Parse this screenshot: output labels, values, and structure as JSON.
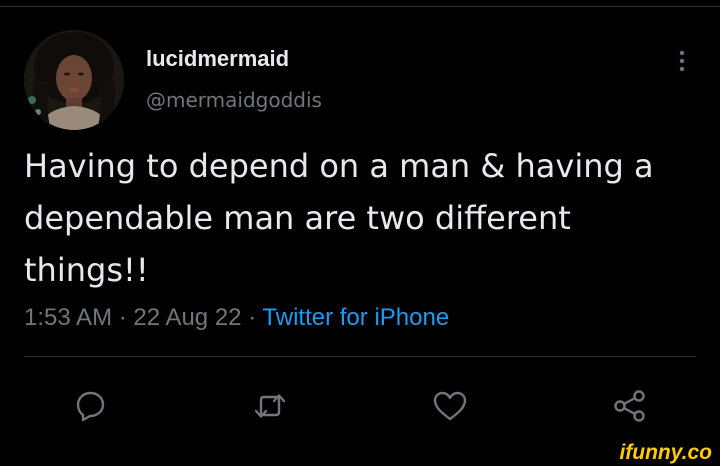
{
  "user": {
    "display_name": "lucidmermaid",
    "handle": "@mermaidgoddis"
  },
  "tweet": {
    "text": "Having to depend on a man & having a dependable man are two different things!!",
    "time": "1:53 AM",
    "date": "22 Aug 22",
    "separator": "·",
    "source": "Twitter for iPhone"
  },
  "icons": {
    "more": "more-options-icon",
    "reply": "reply-icon",
    "retweet": "retweet-icon",
    "like": "like-icon",
    "share": "share-icon"
  },
  "colors": {
    "background": "#000000",
    "text_primary": "#e7e9ea",
    "text_secondary": "#71767b",
    "link": "#1d9bf0",
    "divider": "#2f3336",
    "watermark": "#ffcc00"
  },
  "watermark": {
    "text": "ifunny.co"
  }
}
